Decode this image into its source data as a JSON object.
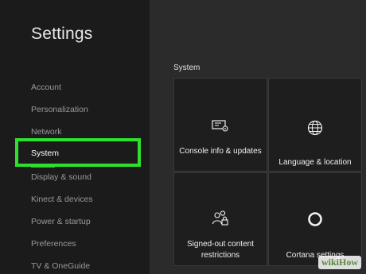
{
  "sidebar": {
    "title": "Settings",
    "items": [
      {
        "label": "Account"
      },
      {
        "label": "Personalization"
      },
      {
        "label": "Network"
      },
      {
        "label": "System"
      },
      {
        "label": "Display & sound"
      },
      {
        "label": "Kinect & devices"
      },
      {
        "label": "Power & startup"
      },
      {
        "label": "Preferences"
      },
      {
        "label": "TV & OneGuide"
      }
    ],
    "active_index": 3
  },
  "main": {
    "section_label": "System",
    "tiles": [
      {
        "label": "Console info & updates",
        "icon": "console-info-icon"
      },
      {
        "label": "Language & location",
        "icon": "globe-icon"
      },
      {
        "label": "Signed-out content restrictions",
        "icon": "users-lock-icon"
      },
      {
        "label": "Cortana settings",
        "icon": "cortana-ring-icon"
      }
    ]
  },
  "watermark": {
    "text": "wikiHow"
  },
  "colors": {
    "highlight": "#2ee02e",
    "accent_underline": "#3cb43c",
    "sidebar_bg": "#1b1b1b",
    "content_bg": "#2b2b2b",
    "tile_bg": "#1e1e1e"
  }
}
